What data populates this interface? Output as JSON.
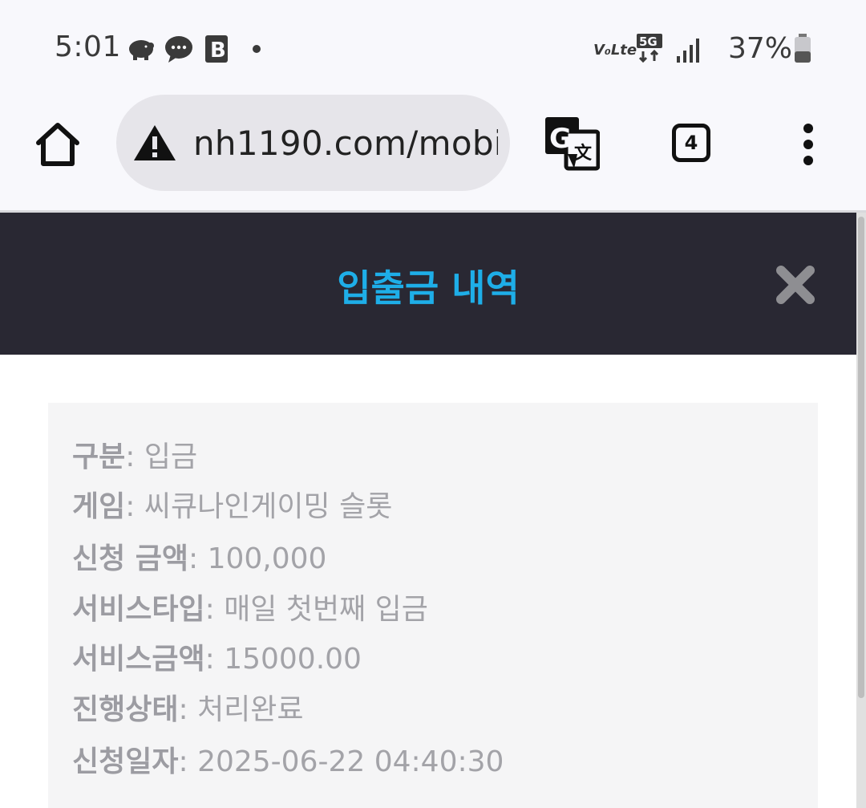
{
  "status_bar": {
    "time": "5:01",
    "battery": "37%",
    "network": "5G"
  },
  "browser": {
    "url": "nh1190.com/mobi",
    "tab_count": "4"
  },
  "modal": {
    "title": "입출금 내역",
    "rows": [
      {
        "label": "구분",
        "value": "입금"
      },
      {
        "label": "게임",
        "value": "씨큐나인게이밍 슬롯"
      },
      {
        "label": "신청 금액",
        "value": "100,000"
      },
      {
        "label": "서비스타입",
        "value": "매일 첫번째 입금"
      },
      {
        "label": "서비스금액",
        "value": "15000.00"
      },
      {
        "label": "진행상태",
        "value": "처리완료"
      },
      {
        "label": "신청일자",
        "value": "2025-06-22 04:40:30"
      }
    ]
  },
  "colors": {
    "header_bg": "#292833",
    "title": "#1eaee8",
    "box_bg": "#f5f5f6",
    "text": "#a3a3a8"
  }
}
